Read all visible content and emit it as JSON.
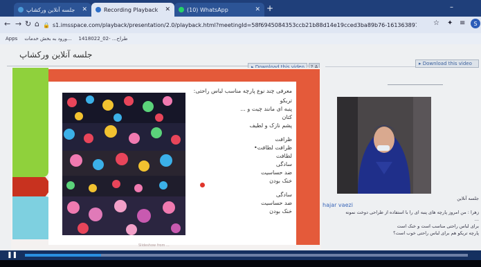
{
  "browser": {
    "tabs": [
      {
        "label": "جلسه آنلاین ورکشاپ",
        "active": false
      },
      {
        "label": "Recording Playback",
        "active": true
      },
      {
        "label": "(10) WhatsApp",
        "active": false
      }
    ],
    "url": "s1.imsspace.com/playback/presentation/2.0/playback.html?meetingId=58f6945084353ccb21b88d14e19cced3ba89b76-1613638978248",
    "bookmarks": [
      "Apps",
      "ورود به بخش خدمات...",
      "طراح... -02_1418022"
    ]
  },
  "page": {
    "title": "جلسه آنلاین ورکشاپ",
    "download_main": "Download this video",
    "download_side": "Download this video",
    "help": "? A"
  },
  "slide": {
    "heading": "معرفی چند نوع پارچه مناسب لباس راحتی:",
    "items": [
      "تریکو",
      "پنبه ای مانند چیت و ...",
      "کتان",
      "پشم نازک و لطیف"
    ],
    "features1": [
      "ظرافت",
      "ظرافت   لطافت•",
      "لطافت",
      "سادگی",
      "ضد حساسیت",
      "خنک بودن"
    ],
    "features2": [
      "سادگی",
      "ضد حساسیت",
      "خنک بودن"
    ],
    "footer": "Slideshow from ..."
  },
  "chat": {
    "header": "جلسه آنلاین",
    "name": "hajar vaezi",
    "lines": [
      "زهرا : من امروز پارچه های پنبه ای را با استفاده از طراحی دوخت نمونه",
      "...",
      "برای لباس راحتی مناسب است و خنک است",
      "پارچه تریکو هم برای لباس راحتی خوب است؟"
    ]
  },
  "colors": {
    "accent_red": "#e45a3a",
    "side_green": "#8fd13c",
    "side_blue": "#7ed0e0",
    "link_blue": "#3a66b8"
  }
}
